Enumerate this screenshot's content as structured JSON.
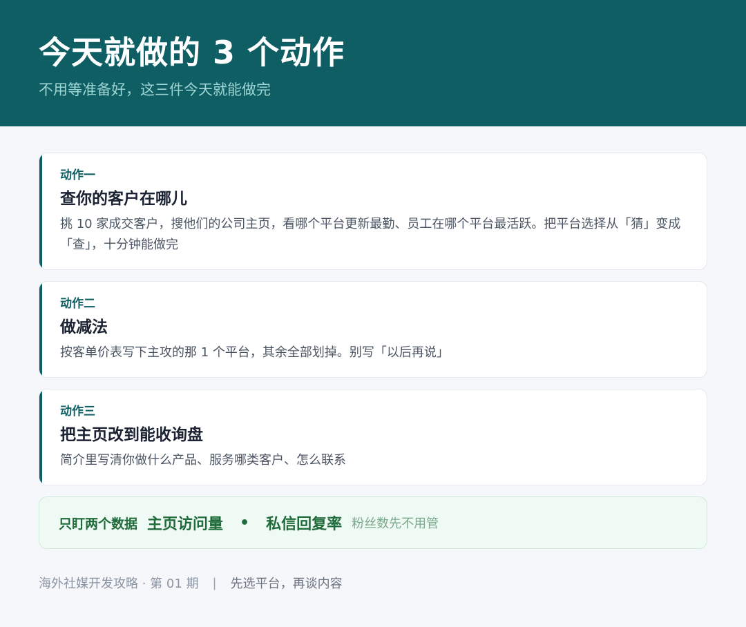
{
  "header": {
    "title": "今天就做的 3 个动作",
    "subtitle": "不用等准备好，这三件今天就能做完"
  },
  "actions": [
    {
      "tag": "动作一",
      "title": "查你的客户在哪儿",
      "desc": "挑 10 家成交客户，搜他们的公司主页，看哪个平台更新最勤、员工在哪个平台最活跃。把平台选择从「猜」变成「查」，十分钟能做完"
    },
    {
      "tag": "动作二",
      "title": "做减法",
      "desc": "按客单价表写下主攻的那 1 个平台，其余全部划掉。别写「以后再说」"
    },
    {
      "tag": "动作三",
      "title": "把主页改到能收询盘",
      "desc": "简介里写清你做什么产品、服务哪类客户、怎么联系"
    }
  ],
  "metrics": {
    "label": "只盯两个数据",
    "metric_1": "主页访问量",
    "separator": "•",
    "metric_2": "私信回复率",
    "note": "粉丝数先不用管"
  },
  "footer": {
    "series": "海外社媒开发攻略 · 第 01 期",
    "divider": "|",
    "slogan": "先选平台，再谈内容"
  },
  "colors": {
    "header_bg": "#0e5e64",
    "accent": "#0e5e64",
    "metrics_bg": "#effaf4",
    "metrics_text": "#1f6b3a"
  }
}
